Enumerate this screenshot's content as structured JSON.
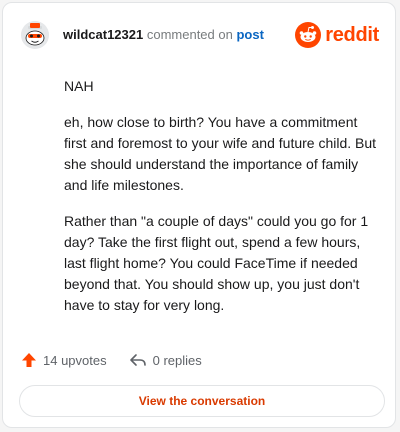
{
  "header": {
    "username": "wildcat12321",
    "verb": "commented on",
    "post_link": "post",
    "brand": "reddit"
  },
  "comment": {
    "paragraphs": [
      "NAH",
      "eh, how close to birth? You have a commitment first and foremost to your wife and future child. But she should understand the importance of family and life milestones.",
      "Rather than \"a couple of days\" could you go for 1 day? Take the first flight out, spend a few hours, last flight home? You could FaceTime if needed beyond that. You should show up, you just don't have to stay for very long."
    ]
  },
  "actions": {
    "upvotes": "14 upvotes",
    "replies": "0 replies"
  },
  "cta": {
    "label": "View the conversation"
  },
  "colors": {
    "accent": "#ff4500",
    "link": "#0a66c2",
    "cta_text": "#d93a00"
  },
  "icons": {
    "upvote": "arrow-up-icon",
    "reply": "reply-arrow-icon",
    "brand": "reddit-snoo-icon"
  }
}
